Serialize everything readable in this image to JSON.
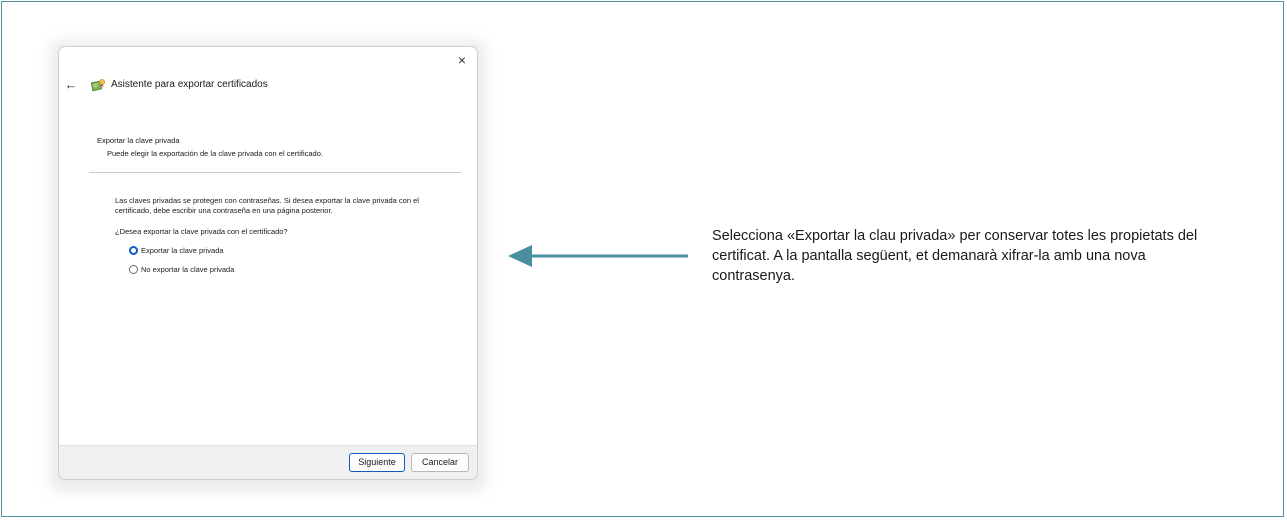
{
  "dialog": {
    "title": "Asistente para exportar certificados",
    "close_icon": "×",
    "back_icon": "←",
    "section_heading": "Exportar la clave privada",
    "section_subtitle": "Puede elegir la exportación de la clave privada con el certificado.",
    "info_text": "Las claves privadas se protegen con contraseñas. Si desea exportar la clave privada con el certificado, debe escribir una contraseña en una página posterior.",
    "question": "¿Desea exportar la clave privada con el certificado?",
    "options": [
      {
        "label": "Exportar la clave privada",
        "selected": true
      },
      {
        "label": "No exportar la clave privada",
        "selected": false
      }
    ],
    "buttons": {
      "next": "Siguiente",
      "cancel": "Cancelar"
    }
  },
  "annotation": {
    "caption": "Selecciona «Exportar la clau privada» per conservar totes les propietats del certificat. A la pantalla següent, et demanarà xifrar-la amb una nova contrasenya.",
    "arrow_color": "#4a8ea0"
  },
  "colors": {
    "frame_border": "#4f8fa0",
    "accent": "#0f5cc0"
  }
}
